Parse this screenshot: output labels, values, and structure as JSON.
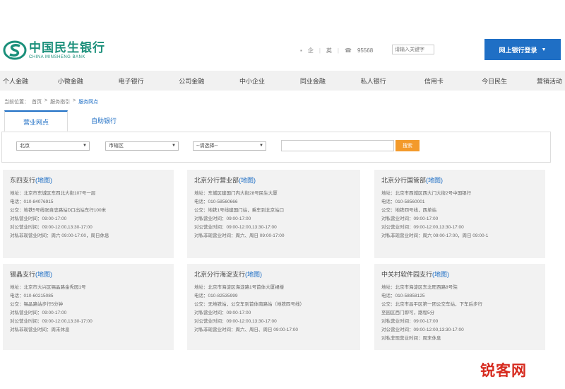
{
  "brand": {
    "name_cn": "中国民生银行",
    "name_en": "CHINA MINSHENG BANK",
    "color": "#1a8f7a"
  },
  "toplinks": [
    "企",
    "|",
    "英",
    "|",
    "95568"
  ],
  "search": {
    "placeholder": "请输入关键字"
  },
  "login_button": {
    "label": "网上银行登录",
    "arrow": "▼",
    "color": "#1f6fc5"
  },
  "nav": [
    "个人金融",
    "小微金融",
    "电子银行",
    "公司金融",
    "中小企业",
    "同业金融",
    "私人银行",
    "信用卡",
    "今日民生",
    "营销活动"
  ],
  "breadcrumb": {
    "prefix": "当前位置：",
    "items": [
      "首页",
      "服务指引",
      "服务网点"
    ],
    "separator": ">"
  },
  "tabs": [
    "营业网点",
    "自助银行"
  ],
  "filter": {
    "city": "北京",
    "district": "市辖区",
    "type": "--请选择--",
    "keyword": "",
    "button": "搜索",
    "button_color": "#f39a2b"
  },
  "map_link": "(地图)",
  "branches": [
    {
      "name": "东四支行",
      "lines": [
        "地址：北京市东城区东四北大街107号一层",
        "电话：010-84076915",
        "公交：地铁5号线张自忠路站D口出站东行100米",
        "对私营业时间：09:00-17:00",
        "对公营业时间：09:00-12:00,13:30-17:00",
        "对私非现营业时间：周六 09:00-17:00，周日休息"
      ]
    },
    {
      "name": "北京分行营业部",
      "lines": [
        "地址：东城区建国门内大街28号民生大厦",
        "电话：010-58560666",
        "公交：地铁1号线建国门站，乘车到北京站口",
        "对私营业时间：09:00-17:00",
        "对公营业时间：09:00-12:00,13:30-17:00",
        "对私非现营业时间：周六、周日 09:00-17:00"
      ]
    },
    {
      "name": "北京分行国管部",
      "lines": [
        "地址：北京市西城区西大门大街2号中国银行",
        "电话：010-58560001",
        "公交：地铁四号线，西单站",
        "对私营业时间：09:00-17:00",
        "对公营业时间：09:00-12:00,13:30-17:00",
        "对私非现营业时间：周六 09:00-17:00，周日 09:00-1"
      ]
    },
    {
      "name": "锡晶支行",
      "lines": [
        "地址：北京市大兴区锡晶路金秀园1号",
        "电话：010-60215085",
        "公交：锡晶路站步行5分钟",
        "对私营业时间：09:00-17:00",
        "对公营业时间：09:00-12:00,13:30-17:00",
        "对私非现营业时间：周末休息"
      ]
    },
    {
      "name": "北京分行海淀支行",
      "lines": [
        "地址：北京市海淀区海淀路1号首体大厦裙楼",
        "电话：010-82535999",
        "公交：无地铁站，公交车到首体南路站（地铁四号线）",
        "对私营业时间：09:00-17:00",
        "对公营业时间：09:00-12:00,13:30-17:00",
        "对私非现营业时间：周六、周日、周日 09:00-17:00"
      ]
    },
    {
      "name": "中关村软件园支行",
      "lines": [
        "地址：北京市海淀区东北旺西路8号院",
        "电话：010-58858125",
        "公交：北京市昌平区第一团公交车站，下车后步行",
        "至园区西门即可，路程5分",
        "对私营业时间：09:00-17:00",
        "对公营业时间：09:00-12:00,13:30-17:00",
        "对私非现营业时间：周末休息"
      ]
    }
  ],
  "watermark": "锐客网"
}
